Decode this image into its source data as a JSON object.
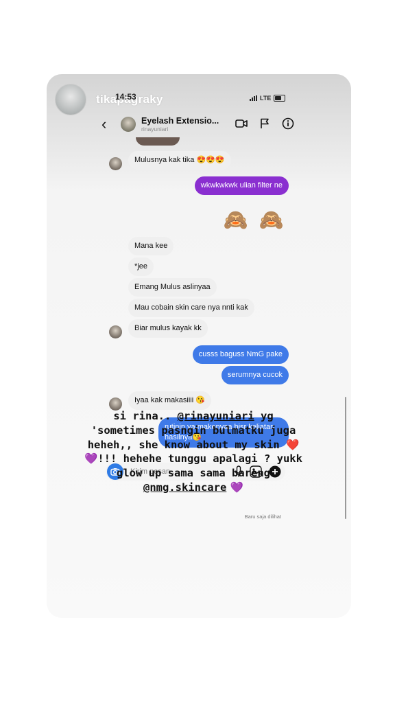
{
  "story": {
    "username": "tikapagraky"
  },
  "status_bar": {
    "time": "14:53",
    "network": "LTE"
  },
  "chat": {
    "title": "Eyelash Extensio...",
    "subtitle": "rinayuniari",
    "messages": [
      {
        "side": "in",
        "text": "Mulusnya kak tika 😍😍😍"
      },
      {
        "side": "out",
        "text": "wkwkwkwk ulian filter ne"
      },
      {
        "side": "out",
        "text": "🙈 🙈"
      },
      {
        "side": "in",
        "text": "Mana kee"
      },
      {
        "side": "in",
        "text": "*jee"
      },
      {
        "side": "in",
        "text": "Emang Mulus aslinyaa"
      },
      {
        "side": "in",
        "text": "Mau cobain skin care nya nnti kak"
      },
      {
        "side": "in",
        "text": "Biar mulus kayak kk"
      },
      {
        "side": "out",
        "text": "cusss baguss NmG pake"
      },
      {
        "side": "out",
        "text": "serumnya cucok"
      },
      {
        "side": "in",
        "text": "Iyaa kak makasiiii 😘"
      },
      {
        "side": "out",
        "line1": "rutinin ya makenyaa bisr keliatan",
        "line2": "hasilnya😘"
      }
    ],
    "seen_label": "Baru saja dilihat",
    "composer_placeholder": "Kirim pesan..."
  },
  "caption": {
    "part1": "si rina.. ",
    "mention1": "@rinayuniari",
    "part2": " yg 'sometimes pasngin bulmatku juga heheh,, she know about my skin ❤️ 💜!!! hehehe tunggu apalagi ? yukk glow up sama sama bareng ",
    "mention2": "@nmg.skincare",
    "part3": " 💜"
  },
  "colors": {
    "purple_bubble": "#8a2fd0",
    "blue_bubble": "#3f7ae8",
    "incoming_bubble": "#efefef"
  },
  "icons": [
    "back-icon",
    "video-call-icon",
    "flag-icon",
    "info-icon",
    "camera-icon",
    "microphone-icon",
    "gallery-icon",
    "plus-icon"
  ]
}
